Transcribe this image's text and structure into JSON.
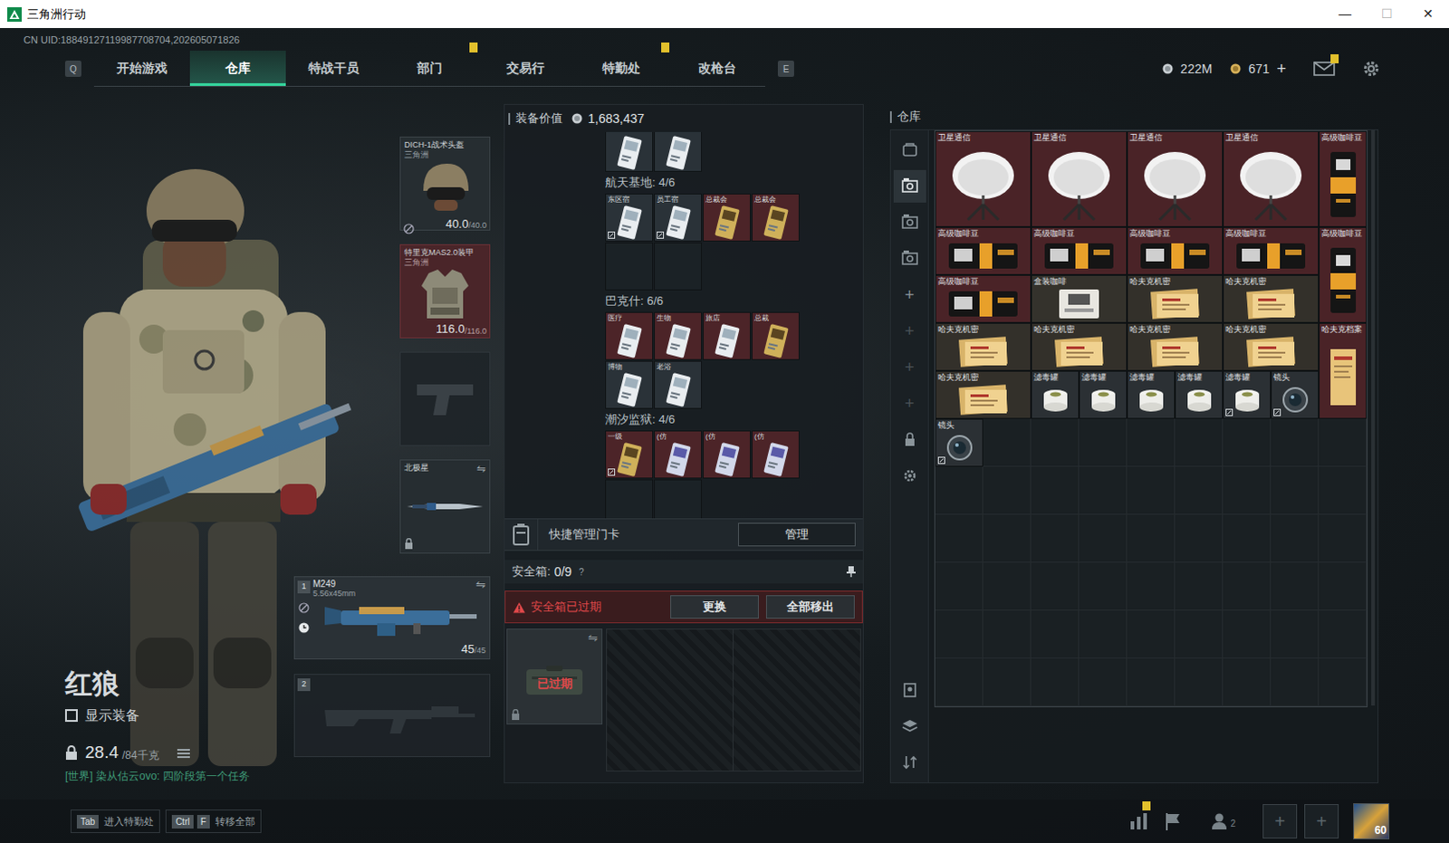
{
  "window": {
    "title": "三角洲行动",
    "controls": [
      "—",
      "☐",
      "✕"
    ]
  },
  "uid": "CN UID:18849127119987708704,202605071826",
  "nav": {
    "prev_key": "Q",
    "next_key": "E",
    "tabs": [
      {
        "label": "开始游戏",
        "selected": false,
        "badge": false
      },
      {
        "label": "仓库",
        "selected": true,
        "badge": false
      },
      {
        "label": "特战干员",
        "selected": false,
        "badge": false
      },
      {
        "label": "部门",
        "selected": false,
        "badge": true
      },
      {
        "label": "交易行",
        "selected": false,
        "badge": false
      },
      {
        "label": "特勤处",
        "selected": false,
        "badge": true
      },
      {
        "label": "改枪台",
        "selected": false,
        "badge": false
      }
    ]
  },
  "currency": {
    "coins": "222M",
    "tickets": "671",
    "add": "+",
    "mail_badge": true
  },
  "operator": {
    "name": "红狼",
    "show_equipment": {
      "label": "显示装备",
      "checked": false
    },
    "weight": "28.4",
    "capacity": "/84千克",
    "chat": "[世界] 染从估云ovo: 四阶段第一个任务"
  },
  "equipment": {
    "helmet": {
      "name": "DICH-1战术头盔",
      "sub": "三角洲",
      "durability": "40.0",
      "max": "/40.0"
    },
    "armor": {
      "name": "特里克MAS2.0装甲",
      "sub": "三角洲",
      "durability": "116.0",
      "max": "/116.0"
    },
    "pistol": {
      "empty": true
    },
    "melee": {
      "name": "北极星",
      "swap": "⇋"
    },
    "weapons": [
      {
        "slot": "1",
        "name": "M249",
        "ammo": "5.56x45mm",
        "rounds": "45",
        "max": "/45",
        "swap": "⇋",
        "empty": false
      },
      {
        "slot": "2",
        "empty": true
      }
    ]
  },
  "loadout": {
    "value_label": "装备价值",
    "value": "1,683,437",
    "keycard_groups": [
      {
        "title": "",
        "cards": [
          {
            "label": "",
            "owned": true,
            "kind": "white",
            "color": "#2a3238",
            "bound": false
          },
          {
            "label": "",
            "owned": true,
            "kind": "white",
            "color": "#2a3238",
            "bound": false
          }
        ]
      },
      {
        "title": "航天基地: 4/6",
        "cards": [
          {
            "label": "东区宿",
            "owned": true,
            "kind": "white",
            "color": "#2a3238",
            "bound": true
          },
          {
            "label": "员工宿",
            "owned": true,
            "kind": "white",
            "color": "#2a3238",
            "bound": true
          },
          {
            "label": "总裁会",
            "owned": true,
            "kind": "gold",
            "color": "#4c2428",
            "bound": false
          },
          {
            "label": "总裁会",
            "owned": true,
            "kind": "gold",
            "color": "#4c2428",
            "bound": false
          },
          {
            "label": "",
            "owned": false,
            "kind": "empty",
            "color": "#1b2226",
            "bound": false
          },
          {
            "label": "",
            "owned": false,
            "kind": "empty",
            "color": "#1b2226",
            "bound": false
          }
        ]
      },
      {
        "title": "巴克什: 6/6",
        "cards": [
          {
            "label": "医疗",
            "owned": true,
            "kind": "white",
            "color": "#4c2428",
            "bound": false
          },
          {
            "label": "生物",
            "owned": true,
            "kind": "white",
            "color": "#4c2428",
            "bound": false
          },
          {
            "label": "旅店",
            "owned": true,
            "kind": "white",
            "color": "#4c2428",
            "bound": false
          },
          {
            "label": "总裁",
            "owned": true,
            "kind": "gold",
            "color": "#4c2428",
            "bound": false
          },
          {
            "label": "博物",
            "owned": true,
            "kind": "white",
            "color": "#2a3238",
            "bound": false
          },
          {
            "label": "老浴",
            "owned": true,
            "kind": "white",
            "color": "#2a3238",
            "bound": false
          }
        ]
      },
      {
        "title": "潮汐监狱: 4/6",
        "cards": [
          {
            "label": "一级",
            "owned": true,
            "kind": "gold",
            "color": "#4c2428",
            "bound": true
          },
          {
            "label": "(仿",
            "owned": true,
            "kind": "blue",
            "color": "#4c2428",
            "bound": false
          },
          {
            "label": "(仿",
            "owned": true,
            "kind": "blue",
            "color": "#4c2428",
            "bound": false
          },
          {
            "label": "(仿",
            "owned": true,
            "kind": "blue",
            "color": "#4c2428",
            "bound": false
          },
          {
            "label": "",
            "owned": false,
            "kind": "empty",
            "color": "#1b2226",
            "bound": false
          },
          {
            "label": "",
            "owned": false,
            "kind": "empty",
            "color": "#1b2226",
            "bound": false
          }
        ]
      }
    ],
    "quick": {
      "label": "快捷管理门卡",
      "button": "管理"
    },
    "safebox": {
      "label": "安全箱:",
      "count": "0/9",
      "help": "?",
      "warning": "安全箱已过期",
      "buttons": [
        "更换",
        "全部移出"
      ],
      "case_label": "已过期",
      "case_swap": "⇋",
      "expired": true
    }
  },
  "stash": {
    "title": "仓库",
    "sidebar_top": [
      {
        "kind": "safe",
        "label": "",
        "selected": false,
        "disabled": false
      },
      {
        "kind": "stash",
        "label": "",
        "selected": true,
        "disabled": false
      },
      {
        "kind": "stash",
        "label": "",
        "selected": false,
        "disabled": false
      },
      {
        "kind": "stash",
        "label": "",
        "selected": false,
        "disabled": false
      },
      {
        "kind": "add",
        "label": "+",
        "selected": false,
        "disabled": false
      },
      {
        "kind": "add",
        "label": "+",
        "selected": false,
        "disabled": true
      },
      {
        "kind": "add",
        "label": "+",
        "selected": false,
        "disabled": true
      },
      {
        "kind": "add",
        "label": "+",
        "selected": false,
        "disabled": true
      },
      {
        "kind": "lock",
        "label": "",
        "selected": false,
        "disabled": false
      },
      {
        "kind": "settings",
        "label": "",
        "selected": false,
        "disabled": false
      }
    ],
    "sidebar_bottom": [
      {
        "kind": "pin",
        "label": "",
        "selected": false,
        "disabled": false
      },
      {
        "kind": "layers",
        "label": "",
        "selected": false,
        "disabled": false
      },
      {
        "kind": "sort",
        "label": "",
        "selected": false,
        "disabled": false
      }
    ],
    "items": [
      {
        "name": "卫星通信",
        "kind": "satellite",
        "color": "#4a2327",
        "bound": false
      },
      {
        "name": "卫星通信",
        "kind": "satellite",
        "color": "#4a2327",
        "bound": false
      },
      {
        "name": "卫星通信",
        "kind": "satellite",
        "color": "#4a2327",
        "bound": false
      },
      {
        "name": "卫星通信",
        "kind": "satellite",
        "color": "#4a2327",
        "bound": false
      },
      {
        "name": "高级咖啡豆",
        "kind": "coffee-tall",
        "color": "#4a2327",
        "bound": false
      },
      {
        "name": "高级咖啡豆",
        "kind": "coffee-wide",
        "color": "#4a2327",
        "bound": false
      },
      {
        "name": "高级咖啡豆",
        "kind": "coffee-wide",
        "color": "#4a2327",
        "bound": false
      },
      {
        "name": "高级咖啡豆",
        "kind": "coffee-wide",
        "color": "#4a2327",
        "bound": false
      },
      {
        "name": "高级咖啡豆",
        "kind": "coffee-wide",
        "color": "#4a2327",
        "bound": false
      },
      {
        "name": "高级咖啡豆",
        "kind": "coffee-tall",
        "color": "#4a2327",
        "bound": false
      },
      {
        "name": "高级咖啡豆",
        "kind": "coffee-wide",
        "color": "#4a2327",
        "bound": false
      },
      {
        "name": "盒装咖啡",
        "kind": "box",
        "color": "#34322c",
        "bound": false
      },
      {
        "name": "哈夫克机密",
        "kind": "doc-wide",
        "color": "#33302a",
        "bound": false
      },
      {
        "name": "哈夫克机密",
        "kind": "doc-wide",
        "color": "#33302a",
        "bound": false
      },
      {
        "name": "哈夫克机密",
        "kind": "doc-wide",
        "color": "#33302a",
        "bound": false
      },
      {
        "name": "哈夫克机密",
        "kind": "doc-wide",
        "color": "#33302a",
        "bound": false
      },
      {
        "name": "哈夫克机密",
        "kind": "doc-wide",
        "color": "#33302a",
        "bound": false
      },
      {
        "name": "哈夫克机密",
        "kind": "doc-wide",
        "color": "#33302a",
        "bound": false
      },
      {
        "name": "哈夫克档案",
        "kind": "archive",
        "color": "#4a2327",
        "bound": false
      },
      {
        "name": "哈夫克机密",
        "kind": "doc-wide",
        "color": "#33302a",
        "bound": false
      },
      {
        "name": "滤毒罐",
        "kind": "filter",
        "color": "#2b3034",
        "bound": false
      },
      {
        "name": "滤毒罐",
        "kind": "filter",
        "color": "#2b3034",
        "bound": false
      },
      {
        "name": "滤毒罐",
        "kind": "filter",
        "color": "#2b3034",
        "bound": false
      },
      {
        "name": "滤毒罐",
        "kind": "filter",
        "color": "#2b3034",
        "bound": false
      },
      {
        "name": "滤毒罐",
        "kind": "filter",
        "color": "#2b3034",
        "bound": true
      },
      {
        "name": "镜头",
        "kind": "lens",
        "color": "#2b3034",
        "bound": true
      },
      {
        "name": "镜头",
        "kind": "lens",
        "color": "#2b3034",
        "bound": true
      }
    ]
  },
  "hints": [
    {
      "keys": [
        "Tab"
      ],
      "label": "进入特勤处"
    },
    {
      "keys": [
        "Ctrl",
        "F"
      ],
      "label": "转移全部"
    }
  ],
  "social": {
    "stats_badge": true,
    "friends": "2",
    "slots": [
      "+",
      "+"
    ],
    "level": "60"
  }
}
